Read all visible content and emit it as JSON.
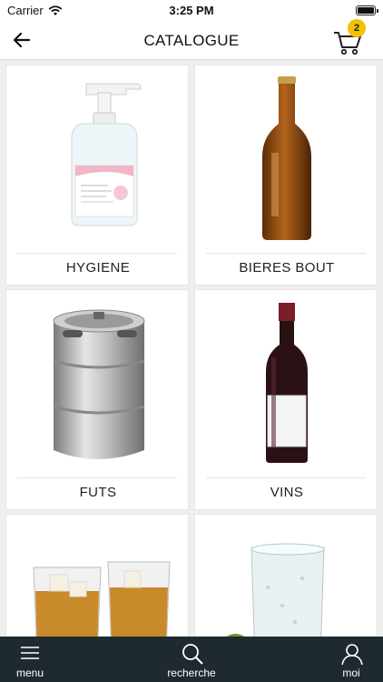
{
  "status_bar": {
    "carrier": "Carrier",
    "time": "3:25 PM"
  },
  "header": {
    "title": "CATALOGUE",
    "cart_count": "2"
  },
  "categories": [
    {
      "label": "HYGIENE",
      "icon": "hand-sanitizer-image"
    },
    {
      "label": "BIERES BOUT",
      "icon": "beer-bottle-image"
    },
    {
      "label": "FUTS",
      "icon": "keg-image"
    },
    {
      "label": "VINS",
      "icon": "wine-bottle-image"
    },
    {
      "label": "",
      "icon": "whisky-glasses-image"
    },
    {
      "label": "",
      "icon": "soda-glass-image"
    }
  ],
  "tab_bar": {
    "menu": "menu",
    "search": "recherche",
    "profile": "moi"
  },
  "colors": {
    "tab_bar_bg": "#1f2a30",
    "badge": "#f2c200"
  }
}
